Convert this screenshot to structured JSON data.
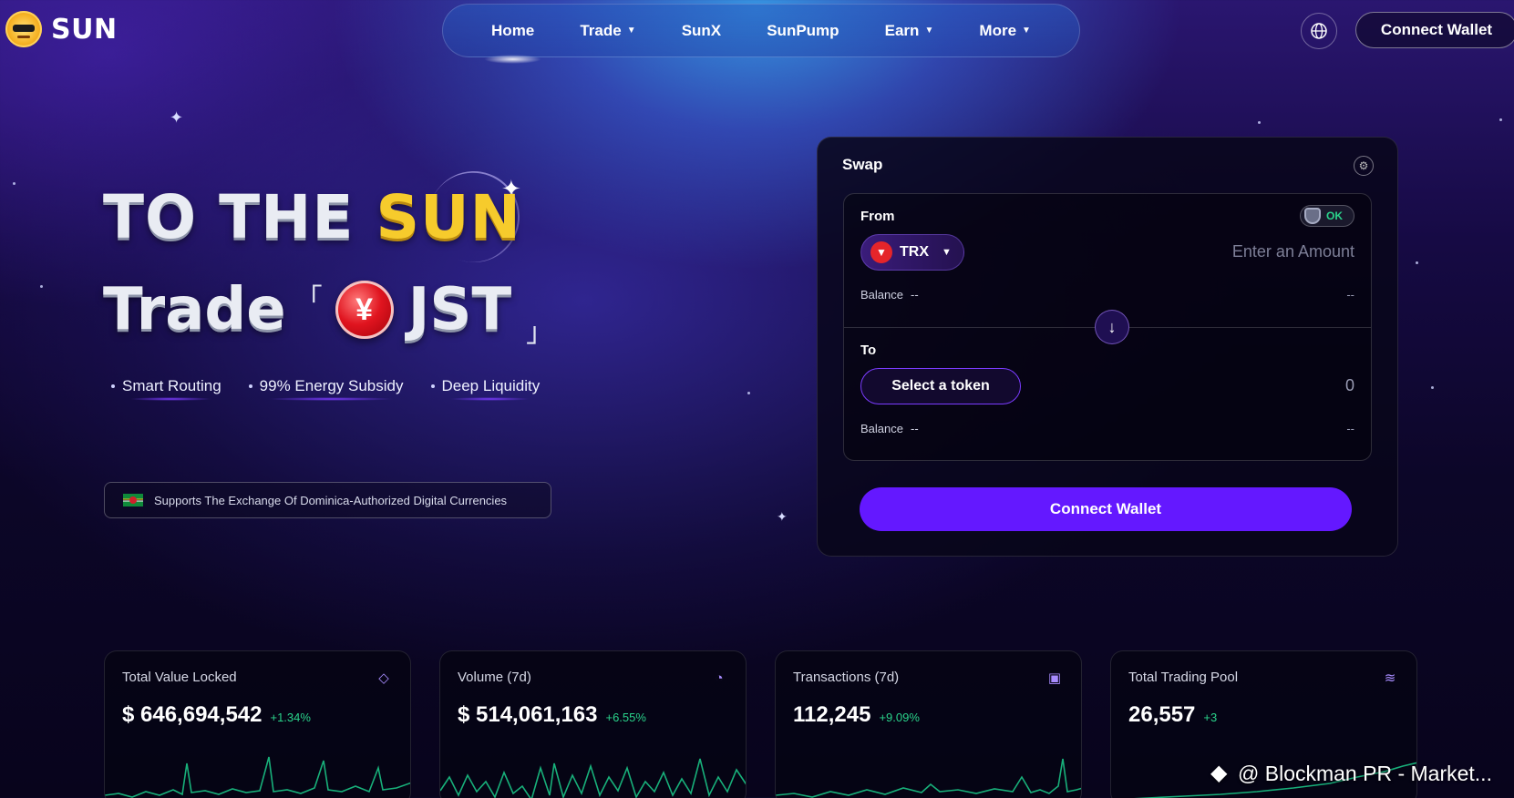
{
  "header": {
    "logo_text": "SUN",
    "nav": [
      {
        "label": "Home",
        "dropdown": false,
        "active": true
      },
      {
        "label": "Trade",
        "dropdown": true
      },
      {
        "label": "SunX",
        "dropdown": false
      },
      {
        "label": "SunPump",
        "dropdown": false
      },
      {
        "label": "Earn",
        "dropdown": true
      },
      {
        "label": "More",
        "dropdown": true
      }
    ],
    "globe_icon": "globe-icon",
    "connect_wallet": "Connect Wallet"
  },
  "hero": {
    "title_prefix": "TO THE",
    "title_highlight": "SUN",
    "trade_word": "Trade",
    "bracket_open": "「",
    "bracket_close": "」",
    "token": "JST",
    "features": [
      "Smart Routing",
      "99% Energy Subsidy",
      "Deep Liquidity"
    ],
    "notice": "Supports The Exchange Of Dominica-Authorized Digital Currencies"
  },
  "swap": {
    "title": "Swap",
    "settings_icon": "settings-icon",
    "from_label": "From",
    "ok_badge": "OK",
    "from_token": "TRX",
    "amount_placeholder": "Enter an Amount",
    "balance_label": "Balance",
    "balance_value": "--",
    "balance_right": "--",
    "to_label": "To",
    "select_token": "Select a token",
    "to_amount": "0",
    "to_balance_label": "Balance",
    "to_balance_value": "--",
    "to_balance_right": "--",
    "connect_wallet": "Connect Wallet"
  },
  "stats": [
    {
      "label": "Total Value Locked",
      "value": "$ 646,694,542",
      "change": "+1.34%",
      "icon": "diamond-icon"
    },
    {
      "label": "Volume (7d)",
      "value": "$ 514,061,163",
      "change": "+6.55%",
      "icon": "pie-chart-icon"
    },
    {
      "label": "Transactions (7d)",
      "value": "112,245",
      "change": "+9.09%",
      "icon": "activity-icon"
    },
    {
      "label": "Total Trading Pool",
      "value": "26,557",
      "change": "+3",
      "icon": "layers-icon"
    }
  ],
  "watermark": "@ Blockman PR - Market...",
  "colors": {
    "accent_purple": "#6418ff",
    "positive_green": "#2ad38b",
    "sun_yellow": "#f6cb2c"
  }
}
